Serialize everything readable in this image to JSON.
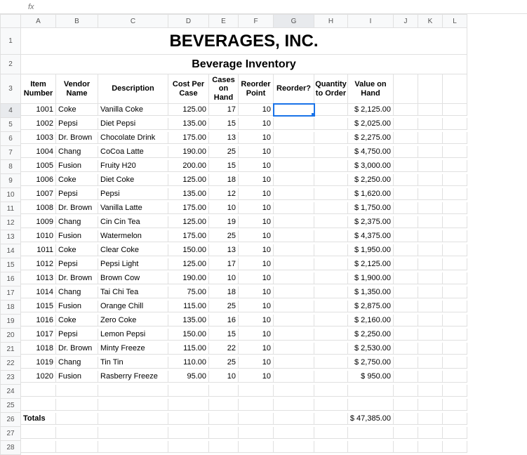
{
  "fx": "fx",
  "columns": [
    "A",
    "B",
    "C",
    "D",
    "E",
    "F",
    "G",
    "H",
    "I",
    "J",
    "K",
    "L"
  ],
  "title": "BEVERAGES, INC.",
  "subtitle": "Beverage Inventory",
  "headers": {
    "item": "Item Number",
    "vendor": "Vendor Name",
    "desc": "Description",
    "cost": "Cost Per Case",
    "cases": "Cases on Hand",
    "reorder_pt": "Reorder Point",
    "reorder": "Reorder?",
    "qty": "Quantity to Order",
    "value": "Value on Hand"
  },
  "rows": [
    {
      "n": "4",
      "item": "1001",
      "vendor": "Coke",
      "desc": "Vanilla Coke",
      "cost": "125.00",
      "cases": "17",
      "rp": "10",
      "val": "$ 2,125.00"
    },
    {
      "n": "5",
      "item": "1002",
      "vendor": "Pepsi",
      "desc": "Diet Pepsi",
      "cost": "135.00",
      "cases": "15",
      "rp": "10",
      "val": "$ 2,025.00"
    },
    {
      "n": "6",
      "item": "1003",
      "vendor": "Dr. Brown",
      "desc": "Chocolate Drink",
      "cost": "175.00",
      "cases": "13",
      "rp": "10",
      "val": "$ 2,275.00"
    },
    {
      "n": "7",
      "item": "1004",
      "vendor": "Chang",
      "desc": "CoCoa Latte",
      "cost": "190.00",
      "cases": "25",
      "rp": "10",
      "val": "$ 4,750.00"
    },
    {
      "n": "8",
      "item": "1005",
      "vendor": "Fusion",
      "desc": "Fruity H20",
      "cost": "200.00",
      "cases": "15",
      "rp": "10",
      "val": "$ 3,000.00"
    },
    {
      "n": "9",
      "item": "1006",
      "vendor": "Coke",
      "desc": "Diet Coke",
      "cost": "125.00",
      "cases": "18",
      "rp": "10",
      "val": "$ 2,250.00"
    },
    {
      "n": "10",
      "item": "1007",
      "vendor": "Pepsi",
      "desc": "Pepsi",
      "cost": "135.00",
      "cases": "12",
      "rp": "10",
      "val": "$ 1,620.00"
    },
    {
      "n": "11",
      "item": "1008",
      "vendor": "Dr. Brown",
      "desc": "Vanilla Latte",
      "cost": "175.00",
      "cases": "10",
      "rp": "10",
      "val": "$ 1,750.00"
    },
    {
      "n": "12",
      "item": "1009",
      "vendor": "Chang",
      "desc": "Cin Cin Tea",
      "cost": "125.00",
      "cases": "19",
      "rp": "10",
      "val": "$ 2,375.00"
    },
    {
      "n": "13",
      "item": "1010",
      "vendor": "Fusion",
      "desc": "Watermelon",
      "cost": "175.00",
      "cases": "25",
      "rp": "10",
      "val": "$ 4,375.00"
    },
    {
      "n": "14",
      "item": "1011",
      "vendor": "Coke",
      "desc": "Clear Coke",
      "cost": "150.00",
      "cases": "13",
      "rp": "10",
      "val": "$ 1,950.00"
    },
    {
      "n": "15",
      "item": "1012",
      "vendor": "Pepsi",
      "desc": "Pepsi Light",
      "cost": "125.00",
      "cases": "17",
      "rp": "10",
      "val": "$ 2,125.00"
    },
    {
      "n": "16",
      "item": "1013",
      "vendor": "Dr. Brown",
      "desc": "Brown Cow",
      "cost": "190.00",
      "cases": "10",
      "rp": "10",
      "val": "$ 1,900.00"
    },
    {
      "n": "17",
      "item": "1014",
      "vendor": "Chang",
      "desc": "Tai Chi Tea",
      "cost": "75.00",
      "cases": "18",
      "rp": "10",
      "val": "$ 1,350.00"
    },
    {
      "n": "18",
      "item": "1015",
      "vendor": "Fusion",
      "desc": "Orange Chill",
      "cost": "115.00",
      "cases": "25",
      "rp": "10",
      "val": "$ 2,875.00"
    },
    {
      "n": "19",
      "item": "1016",
      "vendor": "Coke",
      "desc": "Zero Coke",
      "cost": "135.00",
      "cases": "16",
      "rp": "10",
      "val": "$ 2,160.00"
    },
    {
      "n": "20",
      "item": "1017",
      "vendor": "Pepsi",
      "desc": "Lemon Pepsi",
      "cost": "150.00",
      "cases": "15",
      "rp": "10",
      "val": "$ 2,250.00"
    },
    {
      "n": "21",
      "item": "1018",
      "vendor": "Dr. Brown",
      "desc": "Minty Freeze",
      "cost": "115.00",
      "cases": "22",
      "rp": "10",
      "val": "$ 2,530.00"
    },
    {
      "n": "22",
      "item": "1019",
      "vendor": "Chang",
      "desc": "Tin Tin",
      "cost": "110.00",
      "cases": "25",
      "rp": "10",
      "val": "$ 2,750.00"
    },
    {
      "n": "23",
      "item": "1020",
      "vendor": "Fusion",
      "desc": "Rasberry Freeze",
      "cost": "95.00",
      "cases": "10",
      "rp": "10",
      "val": "$    950.00"
    }
  ],
  "totals_label": "Totals",
  "totals_value": "$ 47,385.00",
  "empty_rows": [
    "24",
    "25",
    "27",
    "28"
  ],
  "totals_row": "26",
  "chart_data": {
    "type": "table",
    "title": "Beverage Inventory",
    "columns": [
      "Item Number",
      "Vendor Name",
      "Description",
      "Cost Per Case",
      "Cases on Hand",
      "Reorder Point",
      "Value on Hand"
    ],
    "data": [
      [
        1001,
        "Coke",
        "Vanilla Coke",
        125.0,
        17,
        10,
        2125.0
      ],
      [
        1002,
        "Pepsi",
        "Diet Pepsi",
        135.0,
        15,
        10,
        2025.0
      ],
      [
        1003,
        "Dr. Brown",
        "Chocolate Drink",
        175.0,
        13,
        10,
        2275.0
      ],
      [
        1004,
        "Chang",
        "CoCoa Latte",
        190.0,
        25,
        10,
        4750.0
      ],
      [
        1005,
        "Fusion",
        "Fruity H20",
        200.0,
        15,
        10,
        3000.0
      ],
      [
        1006,
        "Coke",
        "Diet Coke",
        125.0,
        18,
        10,
        2250.0
      ],
      [
        1007,
        "Pepsi",
        "Pepsi",
        135.0,
        12,
        10,
        1620.0
      ],
      [
        1008,
        "Dr. Brown",
        "Vanilla Latte",
        175.0,
        10,
        10,
        1750.0
      ],
      [
        1009,
        "Chang",
        "Cin Cin Tea",
        125.0,
        19,
        10,
        2375.0
      ],
      [
        1010,
        "Fusion",
        "Watermelon",
        175.0,
        25,
        10,
        4375.0
      ],
      [
        1011,
        "Coke",
        "Clear Coke",
        150.0,
        13,
        10,
        1950.0
      ],
      [
        1012,
        "Pepsi",
        "Pepsi Light",
        125.0,
        17,
        10,
        2125.0
      ],
      [
        1013,
        "Dr. Brown",
        "Brown Cow",
        190.0,
        10,
        10,
        1900.0
      ],
      [
        1014,
        "Chang",
        "Tai Chi Tea",
        75.0,
        18,
        10,
        1350.0
      ],
      [
        1015,
        "Fusion",
        "Orange Chill",
        115.0,
        25,
        10,
        2875.0
      ],
      [
        1016,
        "Coke",
        "Zero Coke",
        135.0,
        16,
        10,
        2160.0
      ],
      [
        1017,
        "Pepsi",
        "Lemon Pepsi",
        150.0,
        15,
        10,
        2250.0
      ],
      [
        1018,
        "Dr. Brown",
        "Minty Freeze",
        115.0,
        22,
        10,
        2530.0
      ],
      [
        1019,
        "Chang",
        "Tin Tin",
        110.0,
        25,
        10,
        2750.0
      ],
      [
        1020,
        "Fusion",
        "Rasberry Freeze",
        95.0,
        10,
        10,
        950.0
      ]
    ],
    "totals": {
      "Value on Hand": 47385.0
    }
  }
}
